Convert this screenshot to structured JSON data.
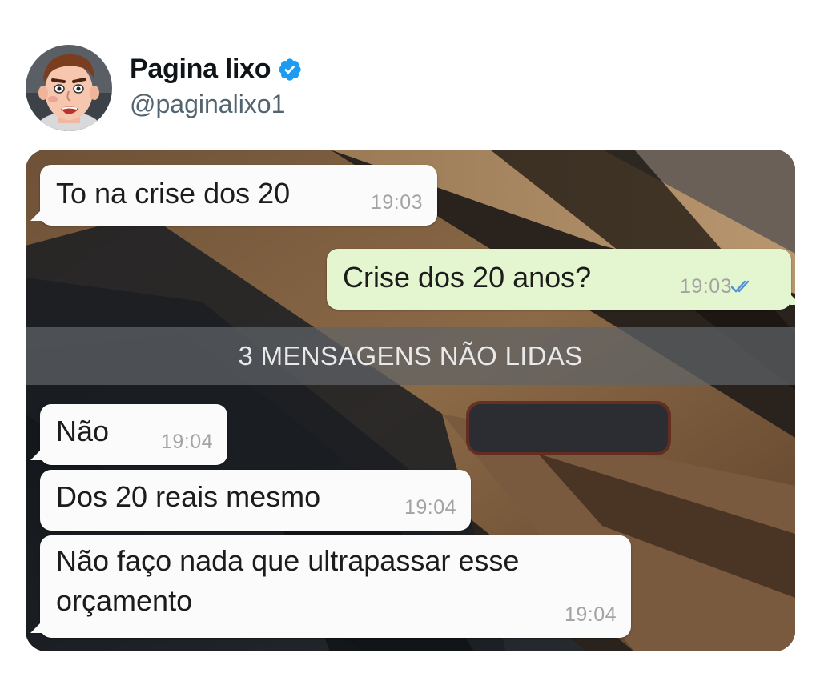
{
  "account": {
    "display_name": "Pagina lixo",
    "handle": "@paginalixo1",
    "verified": true,
    "verified_icon": "verified-badge-icon",
    "verified_color": "#1d9bf0"
  },
  "chat": {
    "messages": [
      {
        "direction": "incoming",
        "text": "To na crise dos 20",
        "time": "19:03"
      },
      {
        "direction": "outgoing",
        "text": "Crise dos 20 anos?",
        "time": "19:03",
        "read_icon": "double-check-icon"
      },
      {
        "direction": "incoming",
        "text": "Não",
        "time": "19:04"
      },
      {
        "direction": "incoming",
        "text": "Dos 20 reais mesmo",
        "time": "19:04"
      },
      {
        "direction": "incoming",
        "text_line1": "Não faço nada que ultrapassar esse",
        "text_line2": "orçamento",
        "time": "19:04"
      }
    ],
    "unread_banner": "3 MENSAGENS NÃO LIDAS",
    "colors": {
      "incoming_bubble": "#fbfbfb",
      "outgoing_bubble": "#e4f6cf",
      "read_ticks": "#4f8fd6"
    }
  }
}
